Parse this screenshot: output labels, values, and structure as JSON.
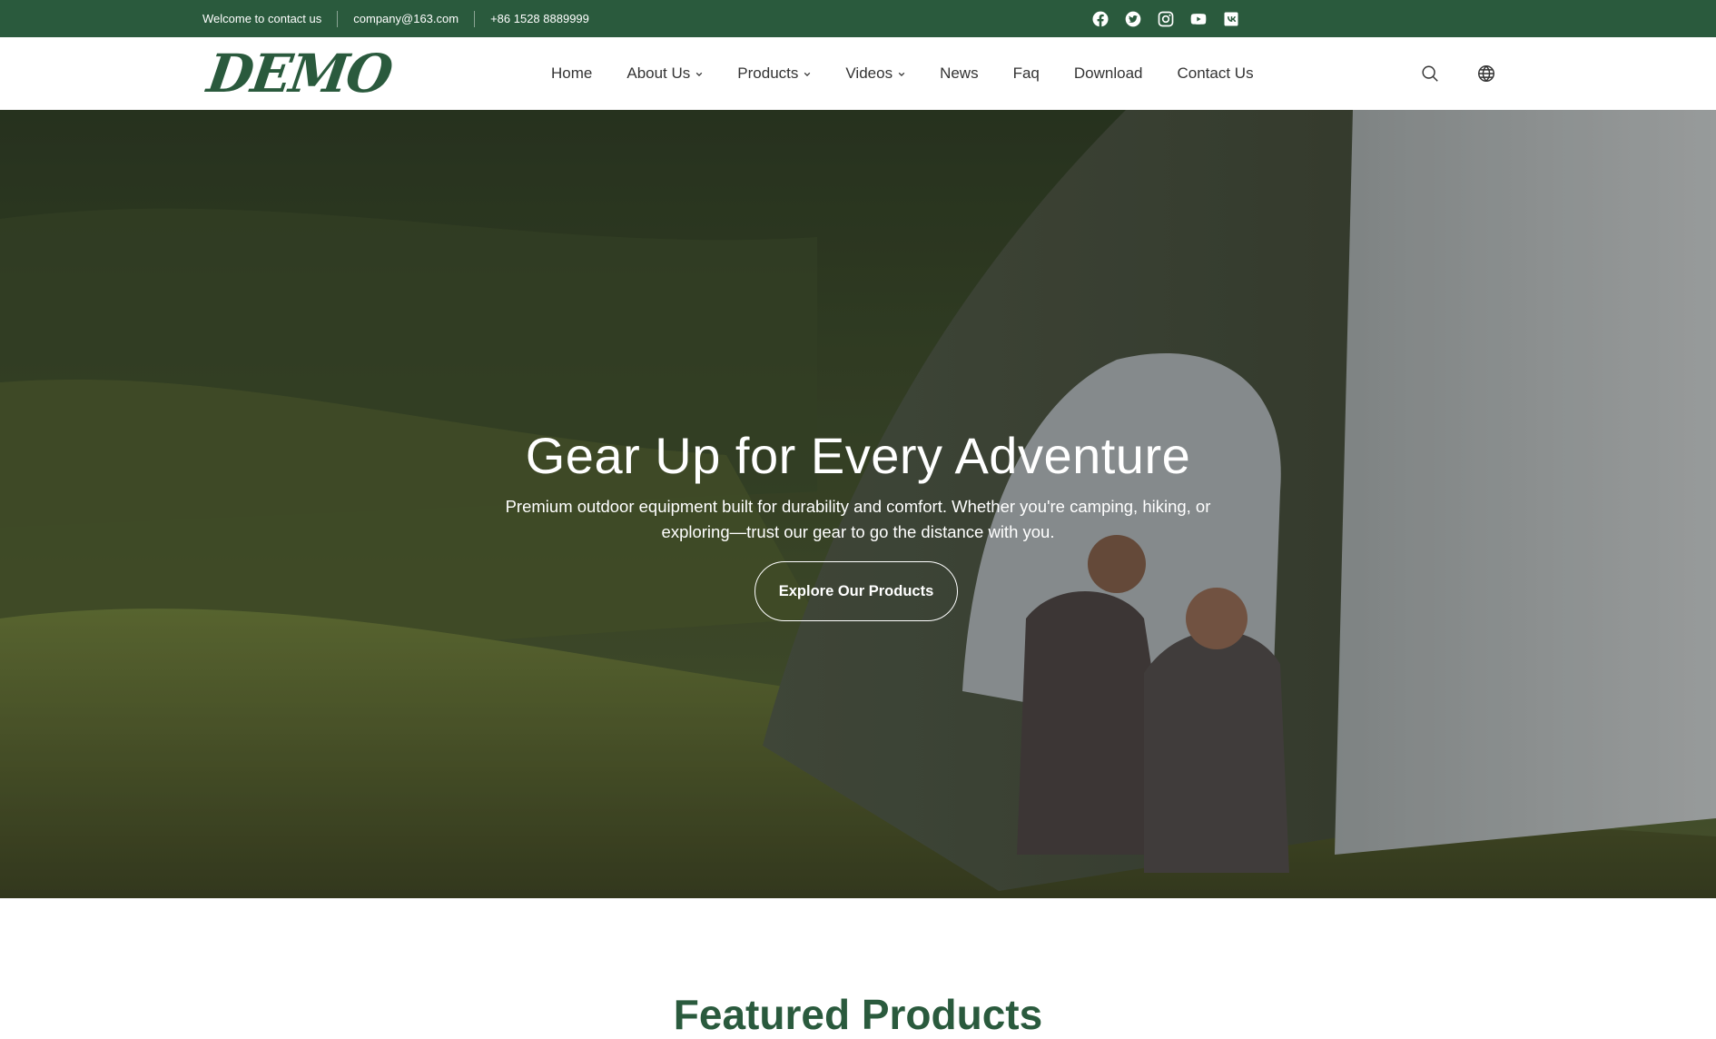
{
  "topbar": {
    "welcome": "Welcome to contact us",
    "email": "company@163.com",
    "phone": "+86 1528 8889999",
    "social_icons": [
      "facebook-icon",
      "twitter-icon",
      "instagram-icon",
      "youtube-icon",
      "vk-icon"
    ]
  },
  "header": {
    "logo": "DEMO",
    "nav": [
      {
        "label": "Home",
        "dropdown": false
      },
      {
        "label": "About Us",
        "dropdown": true
      },
      {
        "label": "Products",
        "dropdown": true
      },
      {
        "label": "Videos",
        "dropdown": true
      },
      {
        "label": "News",
        "dropdown": false
      },
      {
        "label": "Faq",
        "dropdown": false
      },
      {
        "label": "Download",
        "dropdown": false
      },
      {
        "label": "Contact Us",
        "dropdown": false
      }
    ],
    "tools": [
      "search-icon",
      "globe-icon"
    ]
  },
  "hero": {
    "title": "Gear Up for Every Adventure",
    "subtitle": "Premium outdoor equipment built for durability and comfort. Whether you're camping, hiking, or exploring—trust our gear to go the distance with you.",
    "cta": "Explore Our Products"
  },
  "featured": {
    "heading": "Featured Products"
  },
  "colors": {
    "brand_green": "#2a5a3d",
    "white": "#ffffff",
    "nav_text": "#333333"
  }
}
